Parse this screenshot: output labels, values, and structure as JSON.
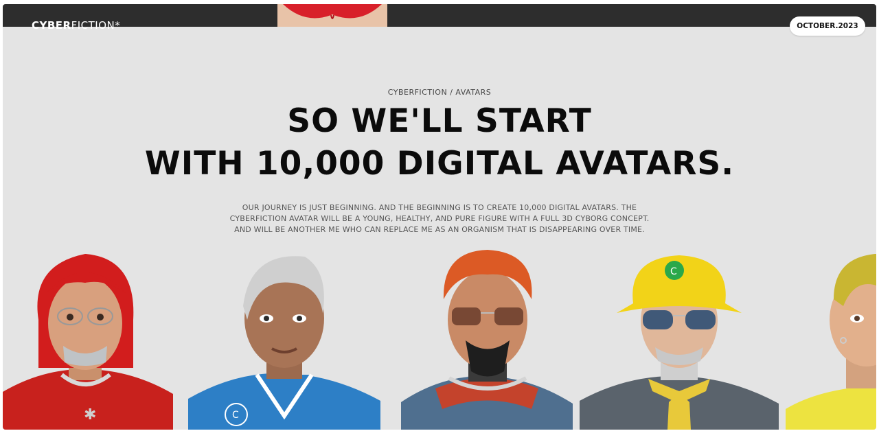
{
  "header": {
    "logo_bold": "CYBER",
    "logo_light": "FICTION*",
    "date": "OCTOBER.2023"
  },
  "hero": {
    "breadcrumb": "CYBERFICTION / AVATARS",
    "headline_line1": "SO WE'LL START",
    "headline_line2": "WITH 10,000 DIGITAL AVATARS.",
    "paragraph_line1": "OUR JOURNEY IS JUST BEGINNING. AND THE BEGINNING IS TO CREATE 10,000 DIGITAL AVATARS. THE",
    "paragraph_line2": "CYBERFICTION AVATAR WILL BE A YOUNG, HEALTHY, AND PURE FIGURE WITH A FULL 3D CYBORG CONCEPT.",
    "paragraph_line3": "AND WILL BE ANOTHER ME WHO CAN REPLACE ME AS AN ORGANISM THAT IS DISAPPEARING OVER TIME."
  },
  "colors": {
    "background": "#e4e4e4",
    "topbar": "#2d2d2d",
    "text": "#0b0b0b"
  }
}
